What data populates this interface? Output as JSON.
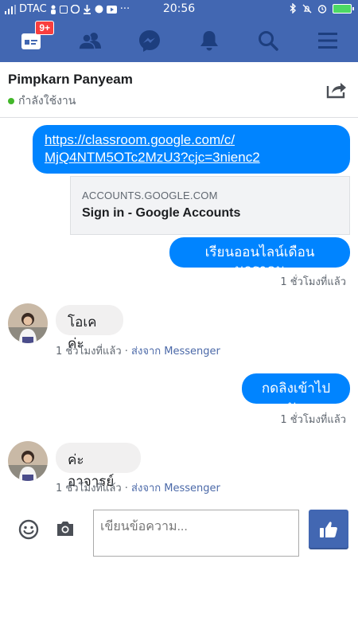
{
  "status_bar": {
    "carrier": "DTAC",
    "time": "20:56",
    "dots": "···"
  },
  "navbar": {
    "notification_badge": "9+",
    "icons": [
      "home-icon",
      "friends-icon",
      "messenger-icon",
      "notifications-icon",
      "search-icon",
      "menu-icon"
    ]
  },
  "header": {
    "contact_name": "Pimpkarn Panyeam",
    "status": "กำลังใช้งาน"
  },
  "messages": {
    "m1_link_line1": "https://classroom.google.com/c/",
    "m1_link_line2": "MjQ4NTM5OTc2MzU3?cjc=3nienc2",
    "preview_domain": "ACCOUNTS.GOOGLE.COM",
    "preview_title": "Sign in - Google Accounts",
    "m2_text": "เรียนออนไลน์เดือนมกราคม",
    "m2_time": "1 ชั่วโมงที่แล้ว",
    "m3_text": "โอเคค่ะ",
    "m3_time": "1 ชั่วโมงที่แล้ว",
    "m3_via": "ส่งจาก Messenger",
    "m4_text": "กดลิงเข้าไปนะ",
    "m4_time": "1 ชั่วโมงที่แล้ว",
    "m5_text": "ค่ะอาจารย์",
    "m5_time": "1 ชั่วโมงที่แล้ว",
    "m5_via": "ส่งจาก Messenger",
    "separator": " · "
  },
  "composer": {
    "placeholder": "เขียนข้อความ..."
  },
  "colors": {
    "brand": "#4267b2",
    "bubble_out": "#0084ff",
    "bubble_in": "#f1f0f0",
    "online": "#42b72a",
    "badge": "#fa3e3e"
  }
}
